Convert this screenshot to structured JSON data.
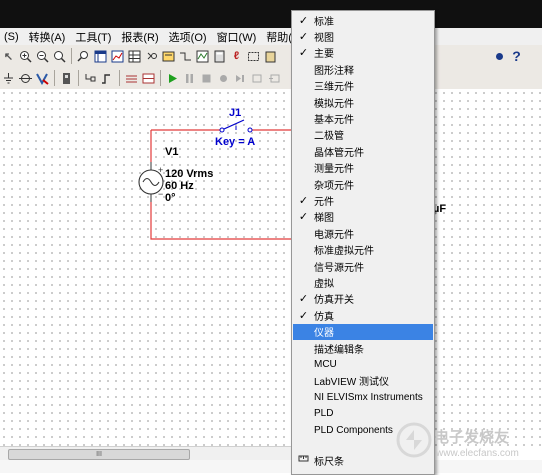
{
  "menubar": {
    "items": [
      "(S)",
      "转换(A)",
      "工具(T)",
      "报表(R)",
      "选项(O)",
      "窗口(W)",
      "帮助(H)"
    ]
  },
  "toolbar": {
    "help_label": "?"
  },
  "circuit": {
    "switch_ref": "J1",
    "switch_key": "Key = A",
    "source_ref": "V1",
    "source_voltage": "120 Vrms",
    "source_freq": "60 Hz",
    "source_phase": "0°",
    "cap_unit_fragment": "µF"
  },
  "context_menu": {
    "items": [
      {
        "label": "标准",
        "checked": true
      },
      {
        "label": "视图",
        "checked": true
      },
      {
        "label": "主要",
        "checked": true
      },
      {
        "label": "图形注释",
        "checked": false
      },
      {
        "label": "三维元件",
        "checked": false
      },
      {
        "label": "模拟元件",
        "checked": false
      },
      {
        "label": "基本元件",
        "checked": false
      },
      {
        "label": "二极管",
        "checked": false
      },
      {
        "label": "晶体管元件",
        "checked": false
      },
      {
        "label": "测量元件",
        "checked": false
      },
      {
        "label": "杂项元件",
        "checked": false
      },
      {
        "label": "元件",
        "checked": true
      },
      {
        "label": "梯图",
        "checked": true
      },
      {
        "label": "电源元件",
        "checked": false
      },
      {
        "label": "标准虚拟元件",
        "checked": false
      },
      {
        "label": "信号源元件",
        "checked": false
      },
      {
        "label": "虚拟",
        "checked": false
      },
      {
        "label": "仿真开关",
        "checked": true
      },
      {
        "label": "仿真",
        "checked": true
      },
      {
        "label": "仪器",
        "checked": false,
        "highlighted": true
      },
      {
        "label": "描述编辑条",
        "checked": false
      },
      {
        "label": "MCU",
        "checked": false
      },
      {
        "label": "LabVIEW 测试仪",
        "checked": false
      },
      {
        "label": "NI ELVISmx Instruments",
        "checked": false
      },
      {
        "label": "PLD",
        "checked": false
      },
      {
        "label": "PLD Components",
        "checked": false
      }
    ],
    "last_item": "标尺条",
    "check_glyph": "✓"
  },
  "scrollbar": {
    "thumb_grip": "III"
  },
  "watermark": {
    "line1": "电子发烧友",
    "line2": "www.elecfans.com"
  },
  "colors": {
    "wire": "#e23a3a",
    "component": "#0000cc",
    "highlight": "#3b83e4"
  }
}
